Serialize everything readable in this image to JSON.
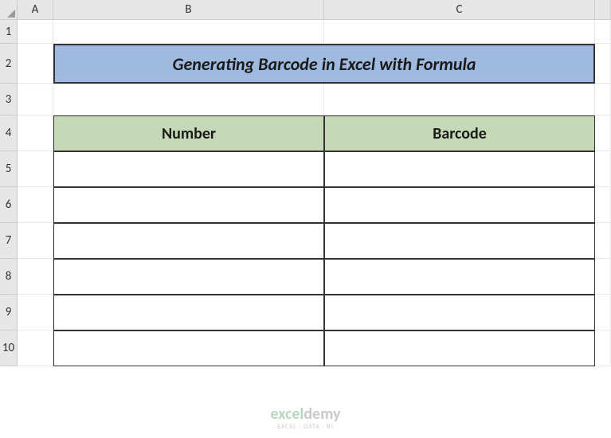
{
  "columns": {
    "A": "A",
    "B": "B",
    "C": "C"
  },
  "rows": {
    "r1": "1",
    "r2": "2",
    "r3": "3",
    "r4": "4",
    "r5": "5",
    "r6": "6",
    "r7": "7",
    "r8": "8",
    "r9": "9",
    "r10": "10"
  },
  "title": "Generating Barcode in Excel with Formula",
  "table": {
    "headers": {
      "number": "Number",
      "barcode": "Barcode"
    },
    "data": [
      {
        "number": "",
        "barcode": ""
      },
      {
        "number": "",
        "barcode": ""
      },
      {
        "number": "",
        "barcode": ""
      },
      {
        "number": "",
        "barcode": ""
      },
      {
        "number": "",
        "barcode": ""
      },
      {
        "number": "",
        "barcode": ""
      }
    ]
  },
  "watermark": {
    "logo_part1": "excel",
    "logo_part2": "demy",
    "tagline": "EXCEL · DATA · BI"
  }
}
